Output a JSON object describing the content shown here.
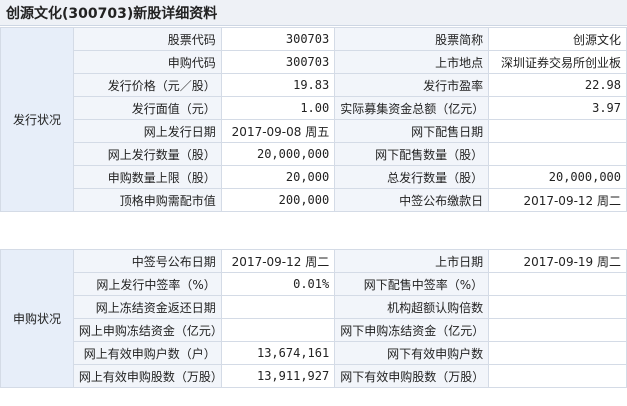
{
  "page_title": "创源文化(300703)新股详细资料",
  "issue": {
    "section_label": "发行状况",
    "rows": [
      [
        {
          "label": "股票代码",
          "value": "300703"
        },
        {
          "label": "股票简称",
          "value": "创源文化"
        }
      ],
      [
        {
          "label": "申购代码",
          "value": "300703"
        },
        {
          "label": "上市地点",
          "value": "深圳证券交易所创业板"
        }
      ],
      [
        {
          "label": "发行价格（元／股）",
          "value": "19.83"
        },
        {
          "label": "发行市盈率",
          "value": "22.98"
        }
      ],
      [
        {
          "label": "发行面值（元）",
          "value": "1.00"
        },
        {
          "label": "实际募集资金总额（亿元）",
          "value": "3.97"
        }
      ],
      [
        {
          "label": "网上发行日期",
          "value": "2017-09-08 周五"
        },
        {
          "label": "网下配售日期",
          "value": ""
        }
      ],
      [
        {
          "label": "网上发行数量（股）",
          "value": "20,000,000"
        },
        {
          "label": "网下配售数量（股）",
          "value": ""
        }
      ],
      [
        {
          "label": "申购数量上限（股）",
          "value": "20,000"
        },
        {
          "label": "总发行数量（股）",
          "value": "20,000,000"
        }
      ],
      [
        {
          "label": "顶格申购需配市值",
          "value": "200,000"
        },
        {
          "label": "中签公布缴款日",
          "value": "2017-09-12 周二"
        }
      ]
    ]
  },
  "subscription": {
    "section_label": "申购状况",
    "rows": [
      [
        {
          "label": "中签号公布日期",
          "value": "2017-09-12 周二"
        },
        {
          "label": "上市日期",
          "value": "2017-09-19 周二"
        }
      ],
      [
        {
          "label": "网上发行中签率（%）",
          "value": "0.01%"
        },
        {
          "label": "网下配售中签率（%）",
          "value": ""
        }
      ],
      [
        {
          "label": "网上冻结资金返还日期",
          "value": ""
        },
        {
          "label": "机构超额认购倍数",
          "value": ""
        }
      ],
      [
        {
          "label": "网上申购冻结资金（亿元）",
          "value": ""
        },
        {
          "label": "网下申购冻结资金（亿元）",
          "value": ""
        }
      ],
      [
        {
          "label": "网上有效申购户数（户）",
          "value": "13,674,161"
        },
        {
          "label": "网下有效申购户数",
          "value": ""
        }
      ],
      [
        {
          "label": "网上有效申购股数（万股）",
          "value": "13,911,927"
        },
        {
          "label": "网下有效申购股数（万股）",
          "value": ""
        }
      ]
    ]
  }
}
